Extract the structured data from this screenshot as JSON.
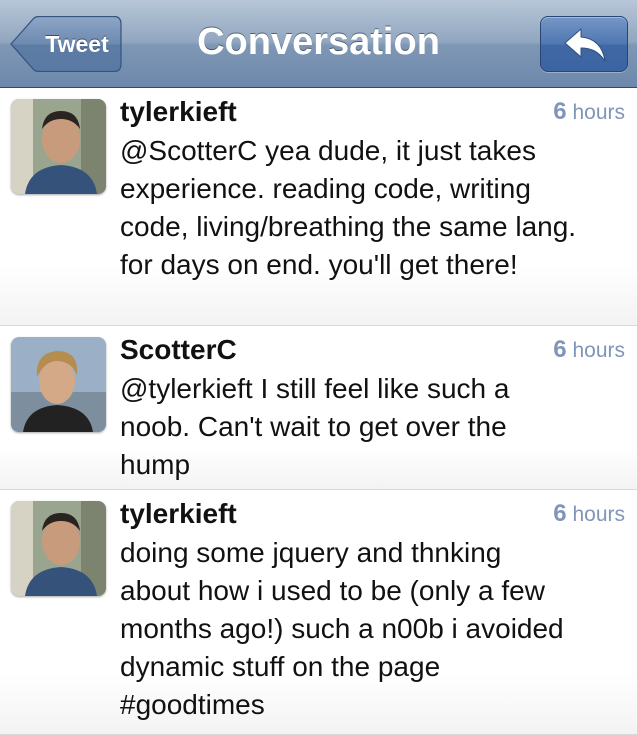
{
  "navbar": {
    "back_label": "Tweet",
    "title": "Conversation",
    "reply_icon": "reply-arrow-icon"
  },
  "colors": {
    "navbar": "#7f97b5",
    "reply_button": "#4f77b1",
    "timestamp": "#8096b8"
  },
  "tweets": [
    {
      "username": "tylerkieft",
      "time_num": "6",
      "time_unit": "hours",
      "text": "@ScotterC yea dude, it just takes\nexperience. reading code, writing\ncode, living/breathing the same lang.\nfor days on end. you'll get there!"
    },
    {
      "username": "ScotterC",
      "time_num": "6",
      "time_unit": "hours",
      "text": "@tylerkieft I still feel like such a\nnoob.  Can't wait to get over the\nhump"
    },
    {
      "username": "tylerkieft",
      "time_num": "6",
      "time_unit": "hours",
      "text": "doing some jquery and thnking\nabout how i used to be (only a few\nmonths ago!) such a n00b i avoided\ndynamic stuff on the page\n#goodtimes"
    }
  ]
}
